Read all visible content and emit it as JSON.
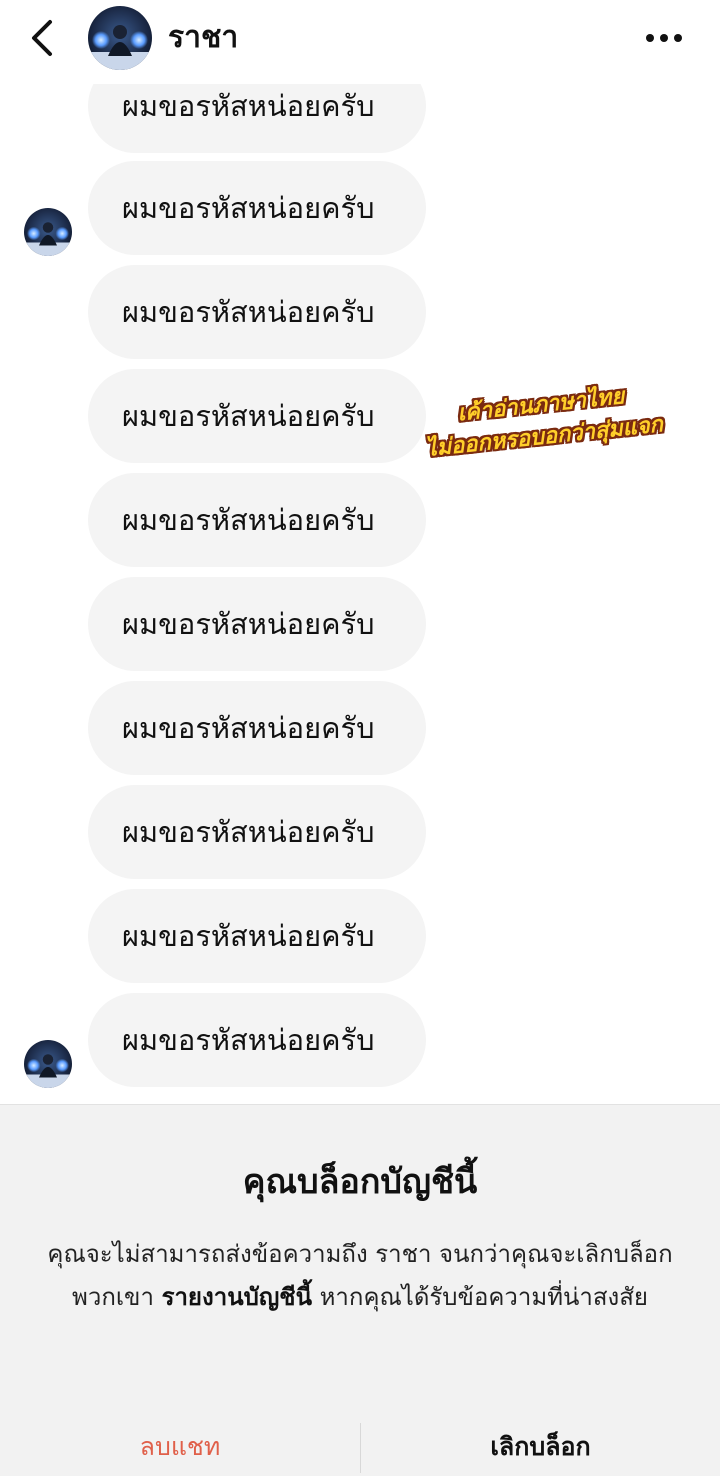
{
  "header": {
    "contact_name": "ราชา",
    "back_icon": "chevron-left-icon",
    "more_icon": "more-horizontal-icon"
  },
  "messages": [
    "ผมขอรหัสหน่อยครับ",
    "ผมขอรหัสหน่อยครับ",
    "ผมขอรหัสหน่อยครับ",
    "ผมขอรหัสหน่อยครับ",
    "ผมขอรหัสหน่อยครับ",
    "ผมขอรหัสหน่อยครับ",
    "ผมขอรหัสหน่อยครับ",
    "ผมขอรหัสหน่อยครับ",
    "ผมขอรหัสหน่อยครับ",
    "ผมขอรหัสหน่อยครับ"
  ],
  "overlay": {
    "line1": "เค้าอ่านภาษาไทย",
    "line2": "ไม่ออกหรอบอกว่าสุ่มแจก"
  },
  "block_panel": {
    "title": "คุณบล็อกบัญชีนี้",
    "desc_before": "คุณจะไม่สามารถส่งข้อความถึง ราชา จนกว่าคุณจะเลิกบล็อกพวกเขา ",
    "report_link": "รายงานบัญชีนี้",
    "desc_after": " หากคุณได้รับข้อความที่น่าสงสัย",
    "delete_chat": "ลบแชท",
    "unblock": "เลิกบล็อก"
  },
  "colors": {
    "bubble_bg": "#f4f4f4",
    "panel_bg": "#f2f2f2",
    "delete_red": "#e0604a",
    "caption_yellow": "#ffcf2a",
    "caption_outline": "#7a2a10"
  }
}
